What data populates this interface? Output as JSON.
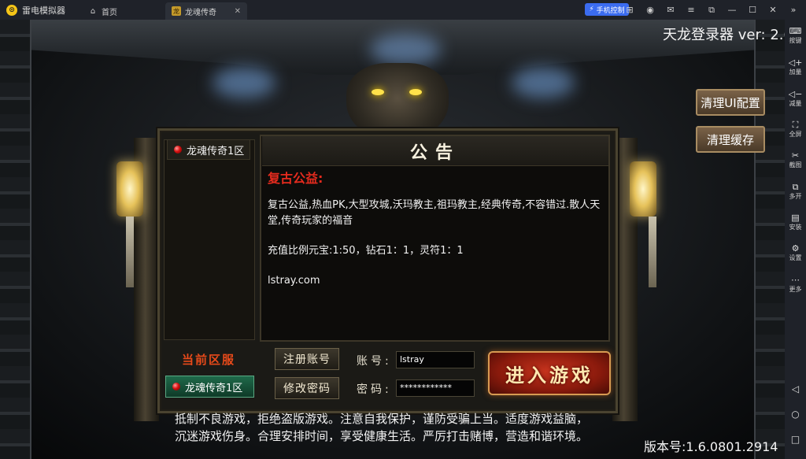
{
  "emulator": {
    "app_name": "雷电模拟器",
    "tabs": [
      {
        "label": "首页",
        "icon": "home-icon"
      },
      {
        "label": "龙魂传奇",
        "icon": "game-icon"
      }
    ],
    "phone_control": "手机控制",
    "sidebar": [
      {
        "label": "按键",
        "icon": "keyboard-icon"
      },
      {
        "label": "加量",
        "icon": "volume-up-icon"
      },
      {
        "label": "减量",
        "icon": "volume-down-icon"
      },
      {
        "label": "全屏",
        "icon": "fullscreen-icon"
      },
      {
        "label": "截图",
        "icon": "scissors-icon"
      },
      {
        "label": "多开",
        "icon": "multi-instance-icon"
      },
      {
        "label": "安装",
        "icon": "apk-install-icon"
      },
      {
        "label": "设置",
        "icon": "settings-icon"
      },
      {
        "label": "更多",
        "icon": "more-icon"
      }
    ]
  },
  "game": {
    "title": "天龙登录器 ver: 2.6",
    "side_buttons": {
      "clear_ui": "清理UI配置",
      "clear_cache": "清理缓存"
    },
    "server_list": [
      "龙魂传奇1区"
    ],
    "notice": {
      "title": "公告",
      "subtitle": "复古公益:",
      "lines": [
        "复古公益,热血PK,大型攻城,沃玛教主,祖玛教主,经典传奇,不容错过.散人天堂,传奇玩家的福音",
        "充值比例元宝:1:50，钻石1：1，灵符1：1",
        "lstray.com"
      ]
    },
    "current_server_label": "当前区服",
    "current_server": "龙魂传奇1区",
    "register_button": "注册账号",
    "change_password_button": "修改密码",
    "account_label": "账号:",
    "account_value": "lstray",
    "password_label": "密码:",
    "password_value": "************",
    "enter_button": "进入游戏",
    "footer_lines": [
      "抵制不良游戏，拒绝盗版游戏。注意自我保护，谨防受骗上当。适度游戏益脑，",
      "沉迷游戏伤身。合理安排时间，享受健康生活。严厉打击赌博，营造和谐环境。"
    ],
    "version": "版本号:1.6.0801.2914"
  }
}
